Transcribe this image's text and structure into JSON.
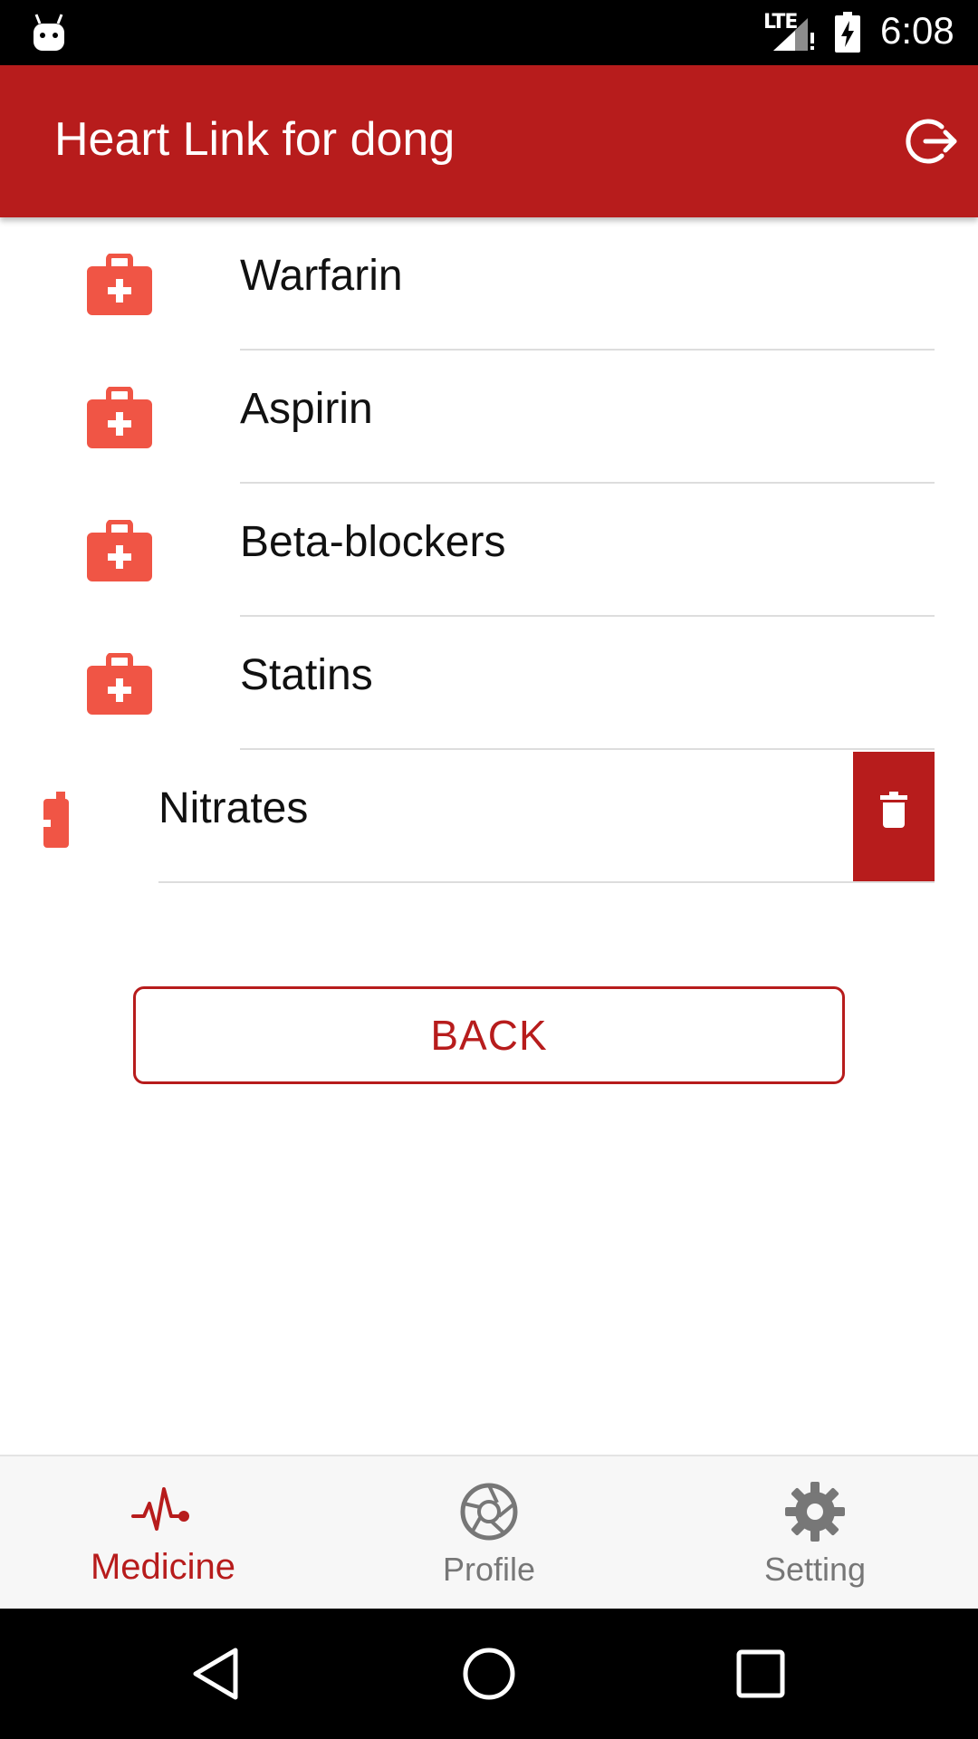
{
  "status_bar": {
    "network": "LTE",
    "time": "6:08",
    "icons": [
      "android-icon",
      "signal-icon",
      "battery-charging-icon"
    ]
  },
  "app_bar": {
    "title": "Heart Link for dong",
    "action_icon": "logout-icon"
  },
  "medicines": [
    {
      "name": "Warfarin",
      "icon": "medical-kit-icon"
    },
    {
      "name": "Aspirin",
      "icon": "medical-kit-icon"
    },
    {
      "name": "Beta-blockers",
      "icon": "medical-kit-icon"
    },
    {
      "name": "Statins",
      "icon": "medical-kit-icon"
    },
    {
      "name": "Nitrates",
      "icon": "medical-kit-icon",
      "swiped": true,
      "action_icon": "trash-icon"
    }
  ],
  "back_button": {
    "label": "BACK"
  },
  "bottom_nav": {
    "items": [
      {
        "label": "Medicine",
        "icon": "heartbeat-icon",
        "active": true
      },
      {
        "label": "Profile",
        "icon": "aperture-icon",
        "active": false
      },
      {
        "label": "Setting",
        "icon": "gear-icon",
        "active": false
      }
    ]
  },
  "colors": {
    "primary": "#b71c1c",
    "icon_red": "#f05545",
    "inactive": "#777777",
    "divider": "#dddddd"
  },
  "system_nav": {
    "icons": [
      "back-triangle-icon",
      "home-circle-icon",
      "recents-square-icon"
    ]
  }
}
